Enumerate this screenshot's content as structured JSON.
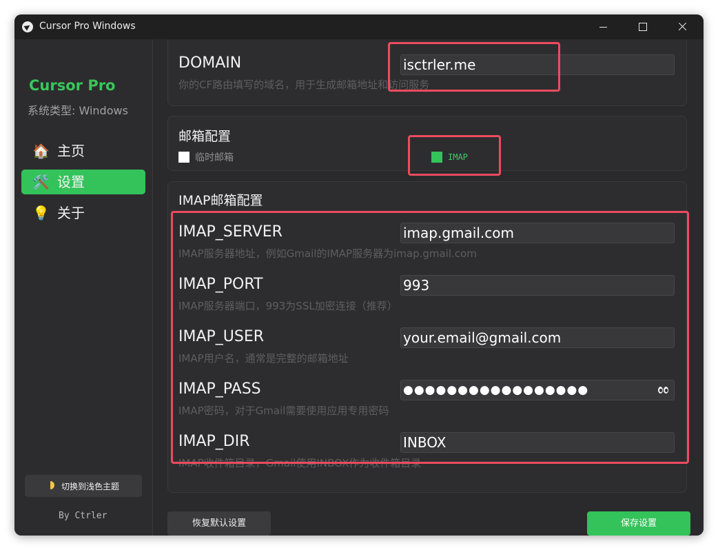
{
  "window": {
    "title": "Cursor Pro Windows"
  },
  "sidebar": {
    "brand": "Cursor Pro",
    "system_type": "系统类型: Windows",
    "items": [
      {
        "icon": "🏠",
        "label": "主页"
      },
      {
        "icon": "🛠️",
        "label": "设置"
      },
      {
        "icon": "💡",
        "label": "关于"
      }
    ],
    "theme_toggle": "切换到浅色主题",
    "credit": "By Ctrler"
  },
  "domain": {
    "label": "DOMAIN",
    "value": "isctrler.me",
    "desc": "你的CF路由填写的域名，用于生成邮箱地址和访问服务"
  },
  "email_config": {
    "title": "邮箱配置",
    "options": [
      {
        "label": "临时邮箱",
        "checked": false
      },
      {
        "label": "IMAP",
        "checked": true
      }
    ]
  },
  "imap": {
    "title": "IMAP邮箱配置",
    "fields": [
      {
        "label": "IMAP_SERVER",
        "value": "imap.gmail.com",
        "desc": "IMAP服务器地址，例如Gmail的IMAP服务器为imap.gmail.com"
      },
      {
        "label": "IMAP_PORT",
        "value": "993",
        "desc": "IMAP服务器端口，993为SSL加密连接（推荐）"
      },
      {
        "label": "IMAP_USER",
        "value": "your.email@gmail.com",
        "desc": "IMAP用户名，通常是完整的邮箱地址"
      },
      {
        "label": "IMAP_PASS",
        "value": "●●●●●●●●●●●●●●●●●",
        "desc": "IMAP密码，对于Gmail需要使用应用专用密码"
      },
      {
        "label": "IMAP_DIR",
        "value": "INBOX",
        "desc": "IMAP收件箱目录，Gmail使用INBOX作为收件箱目录"
      }
    ]
  },
  "footer": {
    "reset_label": "恢复默认设置",
    "save_label": "保存设置"
  },
  "colors": {
    "accent": "#33c35a",
    "highlight": "#ee4b5f"
  }
}
